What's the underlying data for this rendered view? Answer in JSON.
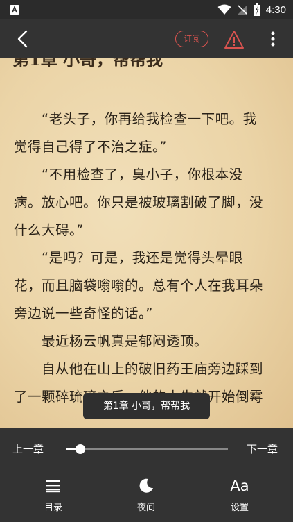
{
  "status_bar": {
    "time": "4:30"
  },
  "top_bar": {
    "subscribe_label": "订阅"
  },
  "reader": {
    "chapter_title": "第1章 小哥，帮帮我",
    "paragraphs": [
      [
        "“老头子，你再给我检查一下吧。我",
        "觉得自己得了不治之症。”"
      ],
      [
        "“不用检查了，臭小子，你根本没",
        "病。放心吧。你只是被玻璃割破了脚，没",
        "什么大碍。”"
      ],
      [
        "“是吗？可是，我还是觉得头晕眼",
        "花，而且脑袋嗡嗡的。总有个人在我耳朵",
        "旁边说一些奇怪的话。”"
      ],
      [
        "最近杨云帆真是郁闷透顶。"
      ],
      [
        "自从他在山上的破旧药王庙旁边踩到",
        "了一颗碎琉璃之后，他的人生就开始倒霉"
      ]
    ]
  },
  "toast": {
    "text": "第1章 小哥，帮帮我"
  },
  "bottom": {
    "prev_label": "上一章",
    "next_label": "下一章",
    "progress": 0.09,
    "nav": [
      {
        "label": "目录",
        "icon": "menu-icon"
      },
      {
        "label": "夜间",
        "icon": "moon-icon"
      },
      {
        "label": "设置",
        "icon": "font-settings-icon",
        "glyph": "Aa"
      }
    ]
  },
  "colors": {
    "accent_red": "#d9534f",
    "page_bg": "#ebd4a7",
    "chrome_bg": "#333333"
  }
}
